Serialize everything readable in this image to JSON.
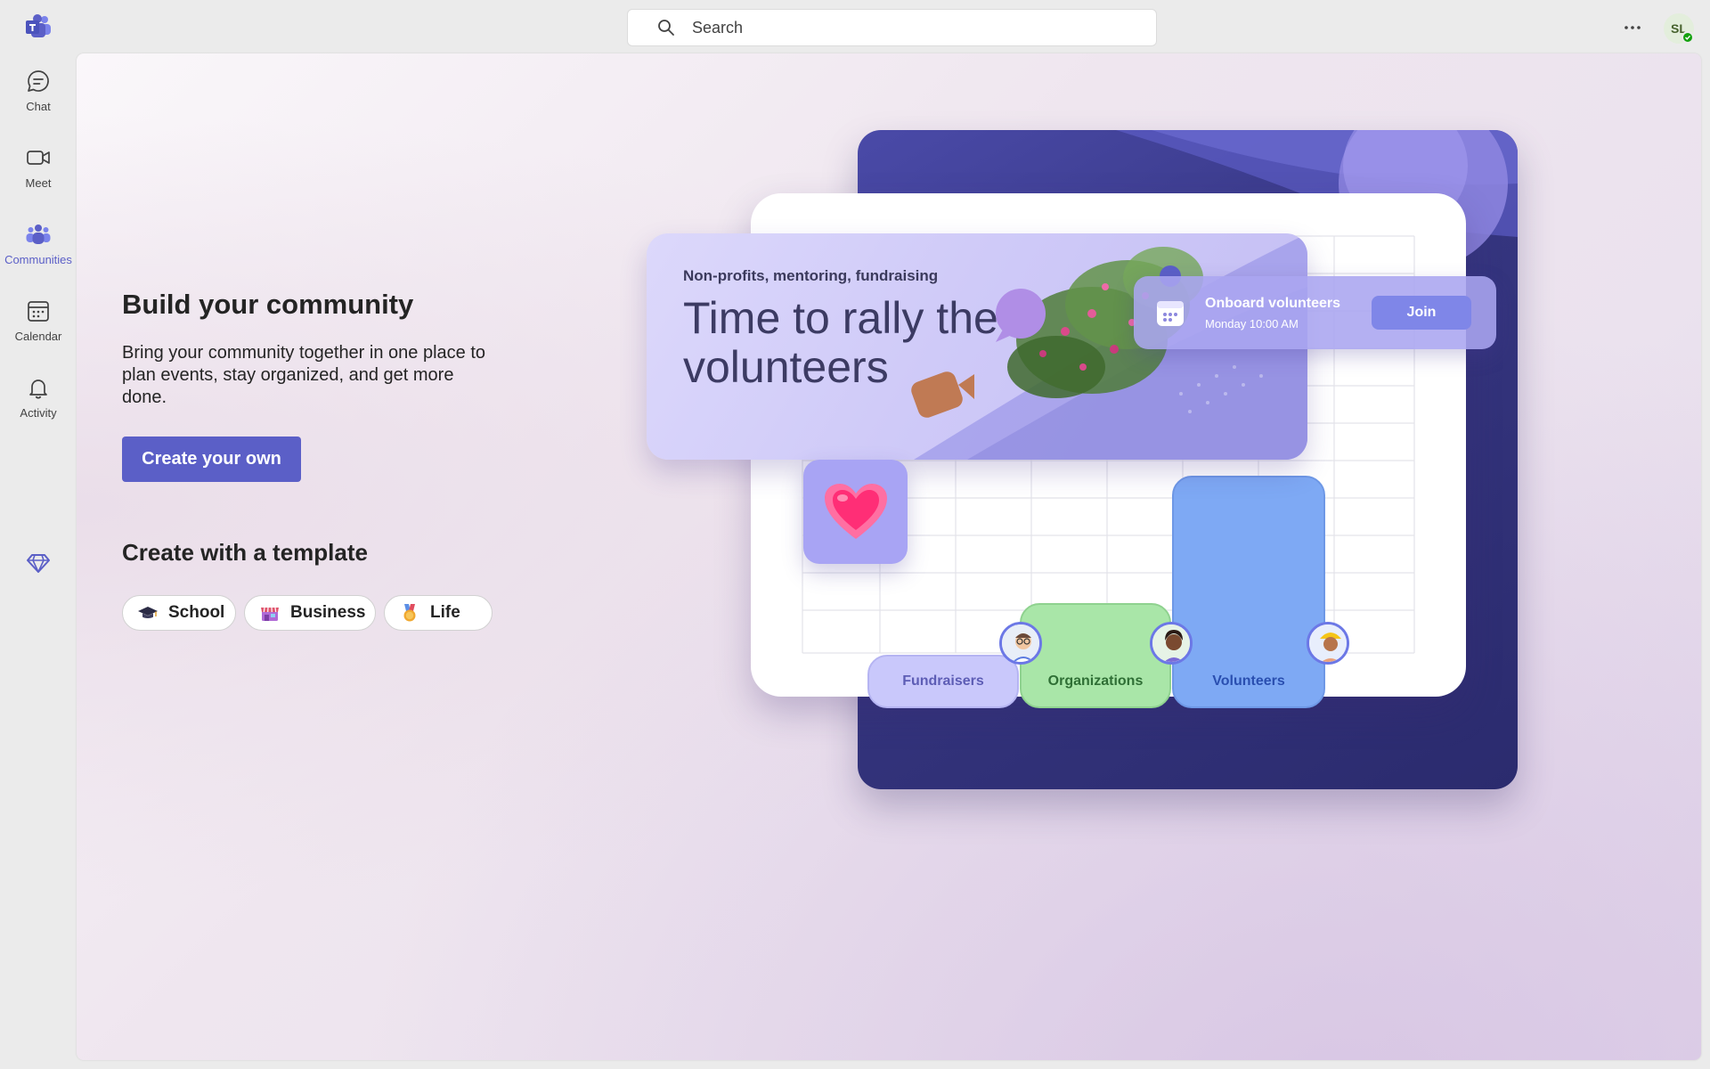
{
  "topbar": {
    "search_placeholder": "Search",
    "more_label": "More options",
    "avatar_initials": "SL",
    "presence_status": "Available"
  },
  "rail": {
    "items": [
      {
        "label": "Chat",
        "icon": "chat-icon"
      },
      {
        "label": "Meet",
        "icon": "video-camera-icon"
      },
      {
        "label": "Communities",
        "icon": "communities-icon",
        "active": true
      },
      {
        "label": "Calendar",
        "icon": "calendar-icon"
      },
      {
        "label": "Activity",
        "icon": "bell-icon"
      }
    ],
    "premium_icon": "diamond-icon"
  },
  "main": {
    "title": "Build your community",
    "description": "Bring your community together in one place to plan events, stay organized, and get more done.",
    "create_button": "Create your own",
    "template_title": "Create with a template",
    "templates": [
      {
        "label": "School",
        "icon": "graduation-cap-icon"
      },
      {
        "label": "Business",
        "icon": "store-icon"
      },
      {
        "label": "Life",
        "icon": "medal-icon"
      }
    ]
  },
  "illustration": {
    "card_subtitle": "Non-profits, mentoring, fundraising",
    "card_title": "Time to rally the volunteers",
    "event_title": "Onboard volunteers",
    "event_time": "Monday 10:00 AM",
    "join_label": "Join",
    "bars": [
      {
        "label": "Fundraisers"
      },
      {
        "label": "Organizations"
      },
      {
        "label": "Volunteers"
      }
    ]
  },
  "colors": {
    "accent": "#5b5fc7",
    "presence": "#13a10e",
    "dark_card": "#35357f"
  }
}
